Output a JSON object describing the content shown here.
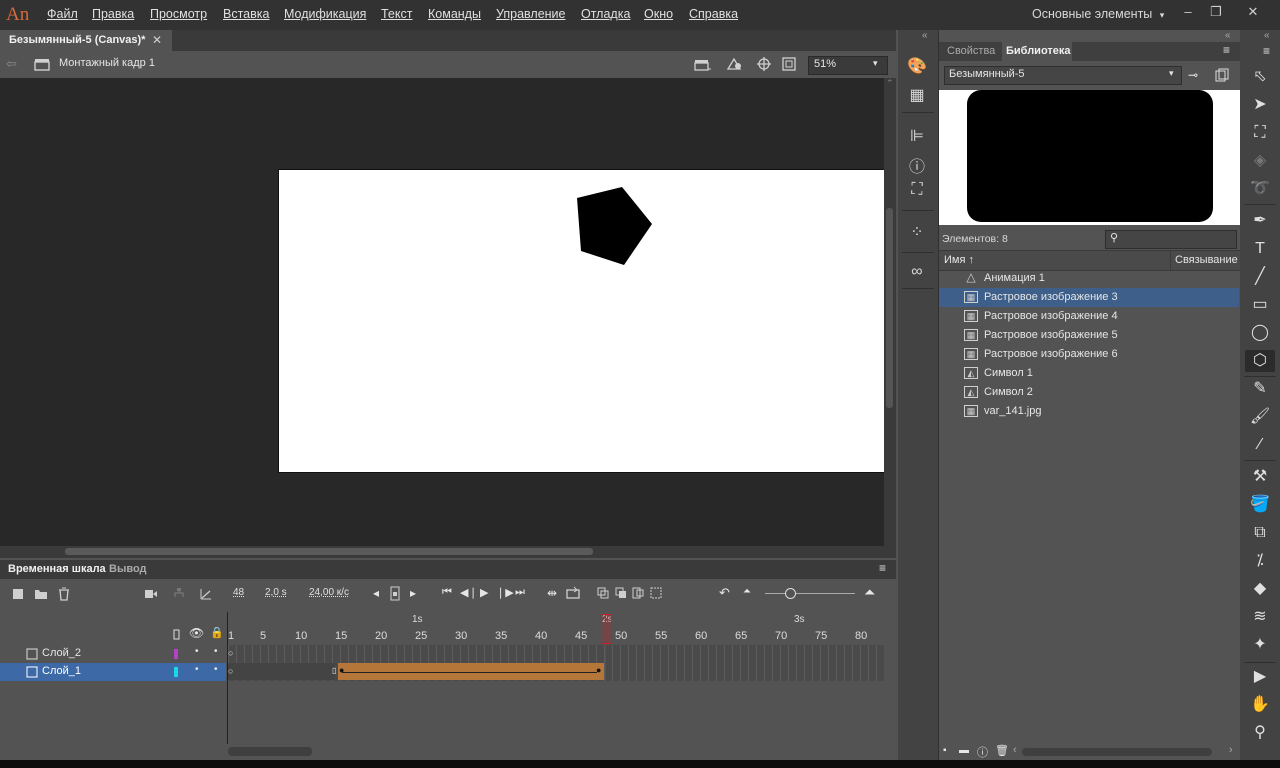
{
  "app": {
    "logo": "An",
    "menu": [
      "Файл",
      "Правка",
      "Просмотр",
      "Вставка",
      "Модификация",
      "Текст",
      "Команды",
      "Управление",
      "Отладка",
      "Окно",
      "Справка"
    ],
    "workspace": "Основные элементы",
    "window_controls": [
      "–",
      "❐",
      "✕"
    ]
  },
  "document": {
    "tab_title": "Безымянный-5 (Canvas)*",
    "tab_close": "✕",
    "scene_name": "Монтажный кадр 1",
    "zoom": "51%"
  },
  "timeline": {
    "tabs": [
      "Временная шкала",
      "Вывод"
    ],
    "frame": "48",
    "time": "2,0 s",
    "fps": "24,00 к/с",
    "seconds_labels": [
      "1s",
      "2s",
      "3s"
    ],
    "frame_labels": [
      "1",
      "5",
      "10",
      "15",
      "20",
      "25",
      "30",
      "35",
      "40",
      "45",
      "50",
      "55",
      "60",
      "65",
      "70",
      "75",
      "80"
    ],
    "layers": [
      {
        "name": "Слой_2",
        "color": "#b640c8",
        "selected": false
      },
      {
        "name": "Слой_1",
        "color": "#19d8e8",
        "selected": true
      }
    ],
    "tween_color": "#b5763a",
    "current_frame": 48
  },
  "library": {
    "tabs": [
      "Свойства",
      "Библиотека"
    ],
    "active_tab": "Библиотека",
    "document": "Безымянный-5",
    "count_label": "Элементов: 8",
    "columns": [
      "Имя ↑",
      "Связывание"
    ],
    "items": [
      {
        "name": "Анимация 1",
        "icon": "animation-symbol-icon",
        "selected": false
      },
      {
        "name": "Растровое изображение 3",
        "icon": "bitmap-icon",
        "selected": true
      },
      {
        "name": "Растровое изображение 4",
        "icon": "bitmap-icon",
        "selected": false
      },
      {
        "name": "Растровое изображение 5",
        "icon": "bitmap-icon",
        "selected": false
      },
      {
        "name": "Растровое изображение 6",
        "icon": "bitmap-icon",
        "selected": false
      },
      {
        "name": "Символ 1",
        "icon": "graphic-symbol-icon",
        "selected": false
      },
      {
        "name": "Символ 2",
        "icon": "graphic-symbol-icon",
        "selected": false
      },
      {
        "name": "var_141.jpg",
        "icon": "bitmap-icon",
        "selected": false
      }
    ]
  },
  "colors": {
    "accent_selection": "#3d5f8a",
    "playhead": "#c8202a",
    "stage": "#ffffff",
    "pasteboard": "#282828"
  }
}
